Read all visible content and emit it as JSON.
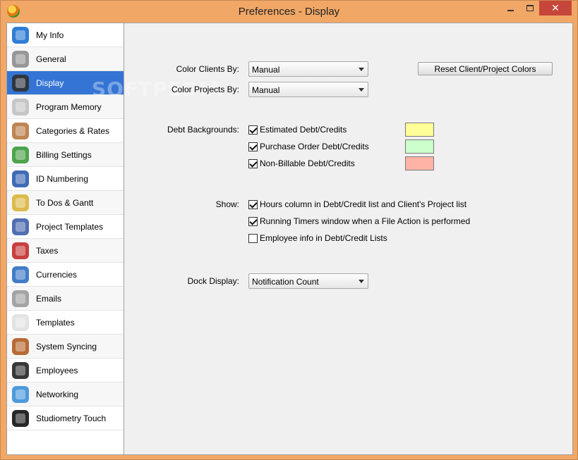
{
  "window": {
    "title": "Preferences - Display",
    "close_glyph": "✕"
  },
  "sidebar": {
    "items": [
      {
        "label": "My Info",
        "icon": "info-icon",
        "color": "#1a6fd1"
      },
      {
        "label": "General",
        "icon": "gears-icon",
        "color": "#8c8c8c"
      },
      {
        "label": "Display",
        "icon": "monitor-icon",
        "color": "#303030"
      },
      {
        "label": "Program Memory",
        "icon": "memory-chart-icon",
        "color": "#c0c0c0"
      },
      {
        "label": "Categories & Rates",
        "icon": "drawers-icon",
        "color": "#b87840"
      },
      {
        "label": "Billing Settings",
        "icon": "money-gear-icon",
        "color": "#3a9a3a"
      },
      {
        "label": "ID Numbering",
        "icon": "id-card-icon",
        "color": "#2b5cae"
      },
      {
        "label": "To Dos & Gantt",
        "icon": "checklist-icon",
        "color": "#d9b23a"
      },
      {
        "label": "Project Templates",
        "icon": "blueprint-pencil-icon",
        "color": "#3d5ea8"
      },
      {
        "label": "Taxes",
        "icon": "magnet-icon",
        "color": "#c22a2a"
      },
      {
        "label": "Currencies",
        "icon": "currency-icon",
        "color": "#2f6fc2"
      },
      {
        "label": "Emails",
        "icon": "envelope-icon",
        "color": "#9a9a9a"
      },
      {
        "label": "Templates",
        "icon": "document-pencil-icon",
        "color": "#e0e0e0"
      },
      {
        "label": "System Syncing",
        "icon": "calendar-sync-icon",
        "color": "#b05a20"
      },
      {
        "label": "Employees",
        "icon": "people-icon",
        "color": "#222222"
      },
      {
        "label": "Networking",
        "icon": "globe-icon",
        "color": "#3a8fd8"
      },
      {
        "label": "Studiometry Touch",
        "icon": "phone-icon",
        "color": "#111111"
      }
    ],
    "active_index": 2
  },
  "watermark": "SOFTPEDIA",
  "display": {
    "color_clients_label": "Color Clients By:",
    "color_clients_value": "Manual",
    "color_projects_label": "Color Projects By:",
    "color_projects_value": "Manual",
    "reset_button": "Reset Client/Project Colors",
    "debt_backgrounds_label": "Debt Backgrounds:",
    "debt": [
      {
        "label": "Estimated Debt/Credits",
        "checked": true,
        "color": "#ffff99"
      },
      {
        "label": "Purchase Order Debt/Credits",
        "checked": true,
        "color": "#ccffcc"
      },
      {
        "label": "Non-Billable Debt/Credits",
        "checked": true,
        "color": "#ffb3a6"
      }
    ],
    "show_label": "Show:",
    "show": [
      {
        "label": "Hours column in Debt/Credit list and Client's Project list",
        "checked": true
      },
      {
        "label": "Running Timers window when a File Action is performed",
        "checked": true
      },
      {
        "label": "Employee info in Debt/Credit Lists",
        "checked": false
      }
    ],
    "dock_label": "Dock Display:",
    "dock_value": "Notification Count"
  }
}
